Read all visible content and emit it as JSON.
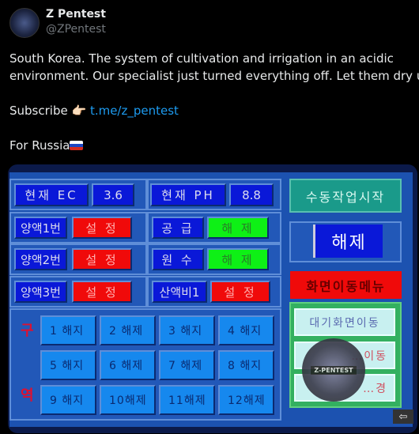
{
  "post": {
    "author": "Z Pentest",
    "handle": "@ZPentest",
    "text_line1": "South Korea. The system of cultivation and irrigation in an acidic",
    "text_line2": "environment. Our specialist just turned everything off. Let them dry up.",
    "subscribe": "Subscribe 👉🏻",
    "link": "t.me/z_pentest",
    "for_russia": "For Russia"
  },
  "hmi": {
    "ec_label": "현재 EC",
    "ec_value": "3.6",
    "ph_label": "현재 PH",
    "ph_value": "8.8",
    "rows": [
      {
        "label": "양액1번",
        "state": "설 정"
      },
      {
        "label": "양액2번",
        "state": "설 정"
      },
      {
        "label": "양액3번",
        "state": "설 정"
      }
    ],
    "right_rows": [
      {
        "label": "공   급",
        "state": "해 제"
      },
      {
        "label": "원   수",
        "state": "해 제"
      },
      {
        "label": "산액비1",
        "state": "설 정"
      }
    ],
    "zone_label_top": "구",
    "zone_label_bottom": "역",
    "zones": [
      "1 해지",
      "2 해제",
      "3 해지",
      "4 해지",
      "5 해지",
      "6 해제",
      "7 해제",
      "8 해지",
      "9 해지",
      "10해제",
      "11해제",
      "12해제"
    ],
    "manual_start": "수동작업시작",
    "release": "해제",
    "screen_menu": "화면이동메뉴",
    "nav_buttons": [
      "대기화면이동",
      "…이동",
      "…경"
    ],
    "watermark": "Z-PENTEST",
    "colors": {
      "blue": "#0a18d8",
      "red": "#f00a0a",
      "green": "#0ef016",
      "teal": "#1a9a8a"
    }
  }
}
